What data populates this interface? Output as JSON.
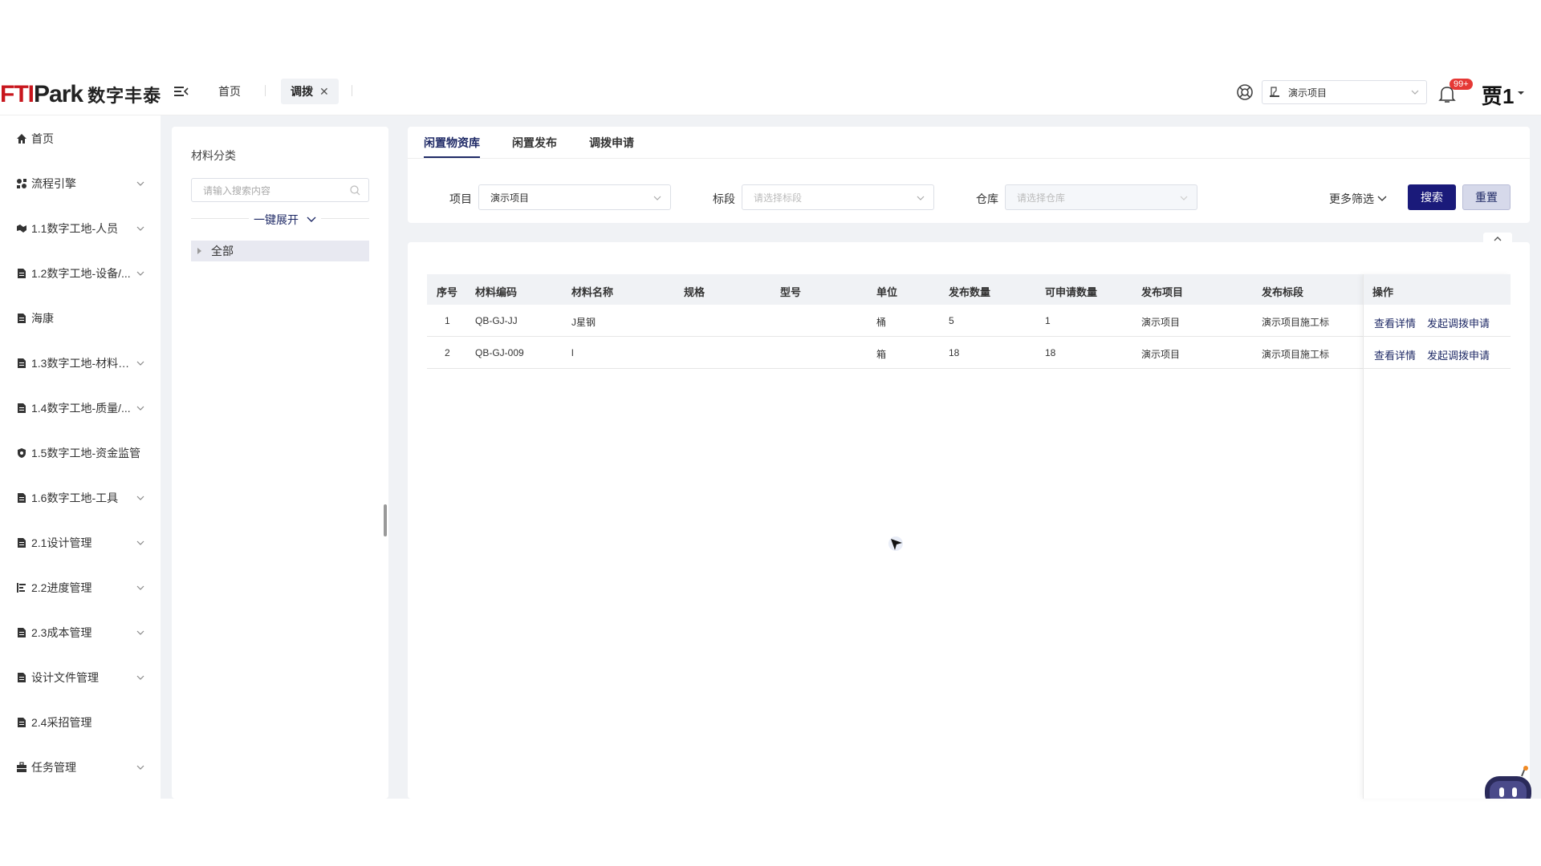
{
  "header": {
    "logo_brand": "FTIPark",
    "logo_brand_ft": "FTI",
    "logo_brand_park": "Park",
    "logo_cn": "数字丰泰",
    "tabs": [
      {
        "label": "首页"
      },
      {
        "label": "调拨"
      }
    ],
    "project_select": "演示项目",
    "notification_badge": "99+",
    "user_name": "贾1"
  },
  "sidebar": {
    "items": [
      {
        "label": "首页",
        "icon": "home-icon",
        "expandable": false
      },
      {
        "label": "流程引擎",
        "icon": "workflow-icon",
        "expandable": true
      },
      {
        "label": "1.1数字工地-人员",
        "icon": "handshake-icon",
        "expandable": true
      },
      {
        "label": "1.2数字工地-设备/...",
        "icon": "document-icon",
        "expandable": true
      },
      {
        "label": "海康",
        "icon": "document-icon",
        "expandable": false
      },
      {
        "label": "1.3数字工地-材料【...",
        "icon": "document-icon",
        "expandable": true
      },
      {
        "label": "1.4数字工地-质量/...",
        "icon": "document-icon",
        "expandable": true
      },
      {
        "label": "1.5数字工地-资金监管",
        "icon": "shield-icon",
        "expandable": false
      },
      {
        "label": "1.6数字工地-工具",
        "icon": "document-icon",
        "expandable": true
      },
      {
        "label": "2.1设计管理",
        "icon": "document-icon",
        "expandable": true
      },
      {
        "label": "2.2进度管理",
        "icon": "gantt-icon",
        "expandable": true
      },
      {
        "label": "2.3成本管理",
        "icon": "document-icon",
        "expandable": true
      },
      {
        "label": "设计文件管理",
        "icon": "document-icon",
        "expandable": true
      },
      {
        "label": "2.4采招管理",
        "icon": "document-icon",
        "expandable": false
      },
      {
        "label": "任务管理",
        "icon": "briefcase-icon",
        "expandable": true
      }
    ]
  },
  "category": {
    "title": "材料分类",
    "search_placeholder": "请输入搜索内容",
    "expand_all": "一键展开",
    "tree_root": "全部"
  },
  "filter": {
    "tabs": [
      "闲置物资库",
      "闲置发布",
      "调拨申请"
    ],
    "active_tab": 0,
    "project_label": "项目",
    "project_value": "演示项目",
    "section_label": "标段",
    "section_placeholder": "请选择标段",
    "warehouse_label": "仓库",
    "warehouse_placeholder": "请选择仓库",
    "more_filter": "更多筛选",
    "search_button": "搜索",
    "reset_button": "重置"
  },
  "table": {
    "columns": [
      "序号",
      "材料编码",
      "材料名称",
      "规格",
      "型号",
      "单位",
      "发布数量",
      "可申请数量",
      "发布项目",
      "发布标段",
      "操作"
    ],
    "rows": [
      {
        "index": "1",
        "code": "QB-GJ-JJ",
        "name": "J星钢",
        "spec": "",
        "model": "",
        "unit": "桶",
        "published_qty": "5",
        "available_qty": "1",
        "project": "演示项目",
        "section": "演示项目施工标",
        "action_view": "查看详情",
        "action_apply": "发起调拨申请"
      },
      {
        "index": "2",
        "code": "QB-GJ-009",
        "name": "l",
        "spec": "",
        "model": "",
        "unit": "箱",
        "published_qty": "18",
        "available_qty": "18",
        "project": "演示项目",
        "section": "演示项目施工标",
        "action_view": "查看详情",
        "action_apply": "发起调拨申请"
      }
    ]
  },
  "colors": {
    "primary": "#1a1a7a",
    "link": "#1f2a66",
    "brand_red": "#c8161d",
    "workspace_bg": "#f0f2f5",
    "badge_red": "#e53935"
  }
}
